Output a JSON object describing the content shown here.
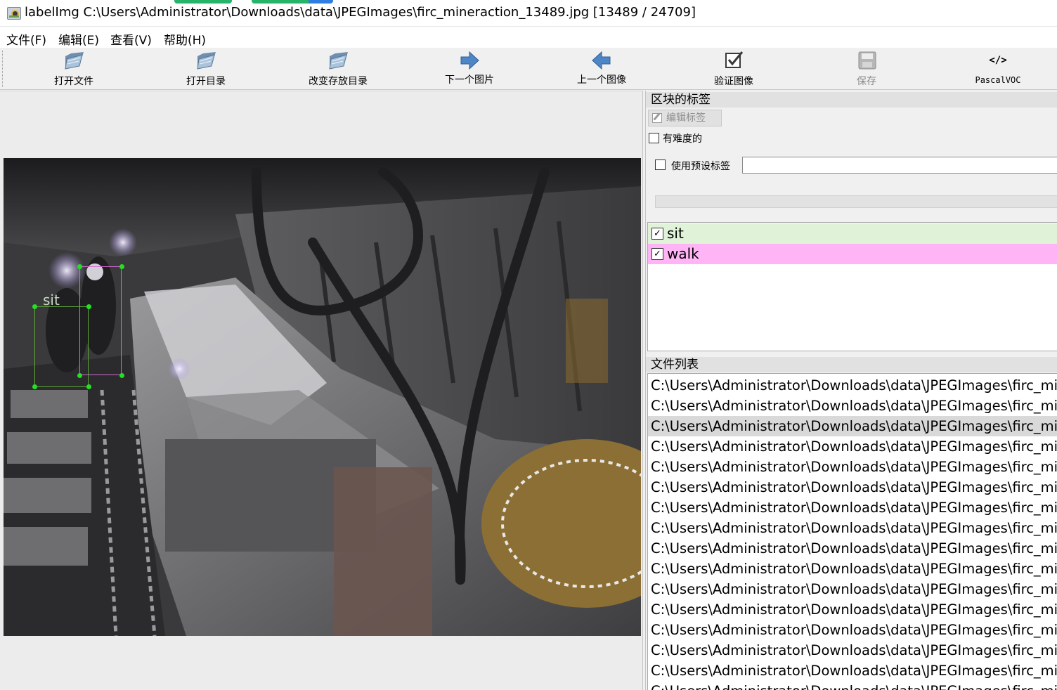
{
  "window": {
    "title": "labelImg C:\\Users\\Administrator\\Downloads\\data\\JPEGImages\\firc_mineraction_13489.jpg [13489 / 24709]"
  },
  "menu": [
    "文件(F)",
    "编辑(E)",
    "查看(V)",
    "帮助(H)"
  ],
  "toolbar": {
    "open_file": "打开文件",
    "open_dir": "打开目录",
    "change_save_dir": "改变存放目录",
    "next_image": "下一个图片",
    "prev_image": "上一个图像",
    "verify_image": "验证图像",
    "save": "保存",
    "format": "PascalVOC",
    "format_icon_text": "</>"
  },
  "canvas": {
    "box_label": "sit"
  },
  "labels_panel": {
    "title": "区块的标签",
    "edit_label_button": "编辑标签",
    "difficult_label": "有难度的",
    "use_default_label": "使用预设标签",
    "default_label_value": "",
    "items": [
      {
        "name": "sit",
        "checked": true,
        "color": "#e0f2d8"
      },
      {
        "name": "walk",
        "checked": true,
        "color": "#ffb5f5"
      }
    ]
  },
  "file_panel": {
    "title": "文件列表",
    "files": [
      "C:\\Users\\Administrator\\Downloads\\data\\JPEGImages\\firc_mir",
      "C:\\Users\\Administrator\\Downloads\\data\\JPEGImages\\firc_mir",
      "C:\\Users\\Administrator\\Downloads\\data\\JPEGImages\\firc_mir",
      "C:\\Users\\Administrator\\Downloads\\data\\JPEGImages\\firc_mir",
      "C:\\Users\\Administrator\\Downloads\\data\\JPEGImages\\firc_mir",
      "C:\\Users\\Administrator\\Downloads\\data\\JPEGImages\\firc_mir",
      "C:\\Users\\Administrator\\Downloads\\data\\JPEGImages\\firc_mir",
      "C:\\Users\\Administrator\\Downloads\\data\\JPEGImages\\firc_mir",
      "C:\\Users\\Administrator\\Downloads\\data\\JPEGImages\\firc_mir",
      "C:\\Users\\Administrator\\Downloads\\data\\JPEGImages\\firc_mir",
      "C:\\Users\\Administrator\\Downloads\\data\\JPEGImages\\firc_mir",
      "C:\\Users\\Administrator\\Downloads\\data\\JPEGImages\\firc_mir",
      "C:\\Users\\Administrator\\Downloads\\data\\JPEGImages\\firc_mir",
      "C:\\Users\\Administrator\\Downloads\\data\\JPEGImages\\firc_mir",
      "C:\\Users\\Administrator\\Downloads\\data\\JPEGImages\\firc_mir",
      "C:\\Users\\Administrator\\Downloads\\data\\JPEGImages\\firc_mir"
    ],
    "selected_index": 2
  },
  "colors": {
    "sit_box": "#5fa83a",
    "walk_box": "#d36ad2",
    "vertex": "#22e022"
  }
}
